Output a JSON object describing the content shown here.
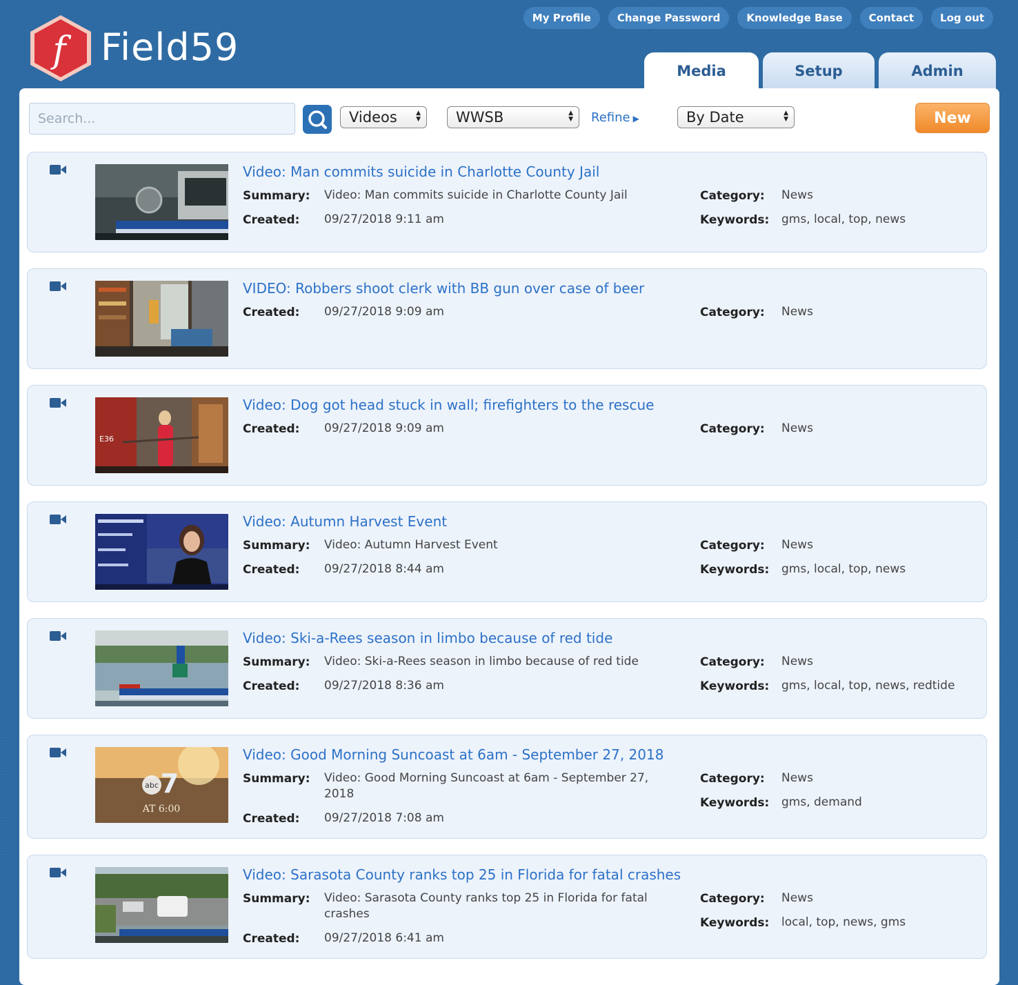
{
  "brand": {
    "name": "Field59",
    "logo_letter": "f"
  },
  "top_links": [
    "My Profile",
    "Change Password",
    "Knowledge Base",
    "Contact",
    "Log out"
  ],
  "tabs": [
    "Media",
    "Setup",
    "Admin"
  ],
  "toolbar": {
    "search_placeholder": "Search...",
    "type_select": "Videos",
    "station_select": "WWSB",
    "refine": "Refine",
    "sort_select": "By Date",
    "new_button": "New"
  },
  "labels": {
    "summary": "Summary:",
    "created": "Created:",
    "category": "Category:",
    "keywords": "Keywords:"
  },
  "items": [
    {
      "title": "Video: Man commits suicide in Charlotte County Jail",
      "summary": "Video: Man commits suicide in Charlotte County Jail",
      "created": "09/27/2018 9:11 am",
      "category": "News",
      "keywords": "gms, local, top, news"
    },
    {
      "title": "VIDEO: Robbers shoot clerk with BB gun over case of beer",
      "created": "09/27/2018 9:09 am",
      "category": "News"
    },
    {
      "title": "Video: Dog got head stuck in wall; firefighters to the rescue",
      "created": "09/27/2018 9:09 am",
      "category": "News"
    },
    {
      "title": "Video: Autumn Harvest Event",
      "summary": "Video: Autumn Harvest Event",
      "created": "09/27/2018 8:44 am",
      "category": "News",
      "keywords": "gms, local, top, news"
    },
    {
      "title": "Video: Ski-a-Rees season in limbo because of red tide",
      "summary": "Video: Ski-a-Rees season in limbo because of red tide",
      "created": "09/27/2018 8:36 am",
      "category": "News",
      "keywords": "gms, local, top, news, redtide"
    },
    {
      "title": "Video: Good Morning Suncoast at 6am - September 27, 2018",
      "summary": "Video: Good Morning Suncoast at 6am - September 27, 2018",
      "created": "09/27/2018 7:08 am",
      "category": "News",
      "keywords": "gms, demand"
    },
    {
      "title": "Video: Sarasota County ranks top 25 in Florida for fatal crashes",
      "summary": "Video: Sarasota County ranks top 25 in Florida for fatal crashes",
      "created": "09/27/2018 6:41 am",
      "category": "News",
      "keywords": "local, top, news, gms"
    }
  ],
  "thumb_texts": {
    "station_logo": "abc",
    "channel": "7",
    "time": "AT 6:00",
    "engine": "E36"
  },
  "colors": {
    "background": "#2d6aa3",
    "link": "#2c71c7",
    "new_button": "#f08a2a",
    "logo_red": "#d9323a"
  }
}
